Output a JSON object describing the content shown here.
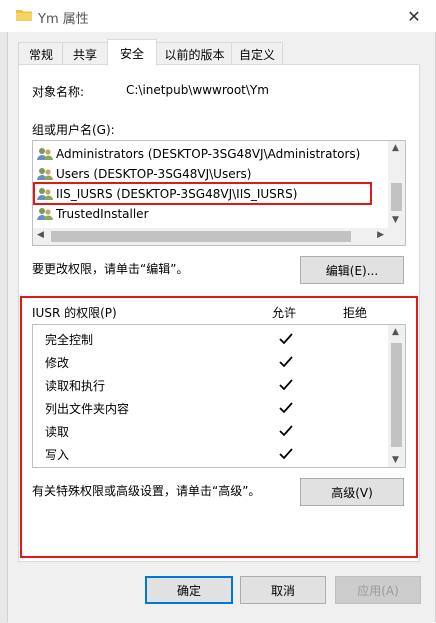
{
  "window": {
    "title": "Ym 属性",
    "close_glyph": "✕"
  },
  "tabs": [
    {
      "label": "常规"
    },
    {
      "label": "共享"
    },
    {
      "label": "安全"
    },
    {
      "label": "以前的版本"
    },
    {
      "label": "自定义"
    }
  ],
  "object": {
    "label": "对象名称:",
    "value": "C:\\inetpub\\wwwroot\\Ym"
  },
  "groups": {
    "label": "组或用户名(G):",
    "items": [
      {
        "label": "Administrators (DESKTOP-3SG48VJ\\Administrators)"
      },
      {
        "label": "Users (DESKTOP-3SG48VJ\\Users)"
      },
      {
        "label": "IIS_IUSRS (DESKTOP-3SG48VJ\\IIS_IUSRS)"
      },
      {
        "label": "TrustedInstaller"
      }
    ]
  },
  "edit": {
    "hint": "要更改权限，请单击“编辑”。",
    "button": "编辑(E)..."
  },
  "permissions": {
    "title": "IUSR 的权限(P)",
    "allow_header": "允许",
    "deny_header": "拒绝",
    "rows": [
      {
        "label": "完全控制",
        "allow": true
      },
      {
        "label": "修改",
        "allow": true
      },
      {
        "label": "读取和执行",
        "allow": true
      },
      {
        "label": "列出文件夹内容",
        "allow": true
      },
      {
        "label": "读取",
        "allow": true
      },
      {
        "label": "写入",
        "allow": true
      }
    ]
  },
  "advanced": {
    "hint": "有关特殊权限或高级设置，请单击“高级”。",
    "button": "高级(V)"
  },
  "footer": {
    "ok": "确定",
    "cancel": "取消",
    "apply": "应用(A)"
  },
  "colors": {
    "highlight": "#e01818",
    "focus": "#0078d7"
  }
}
